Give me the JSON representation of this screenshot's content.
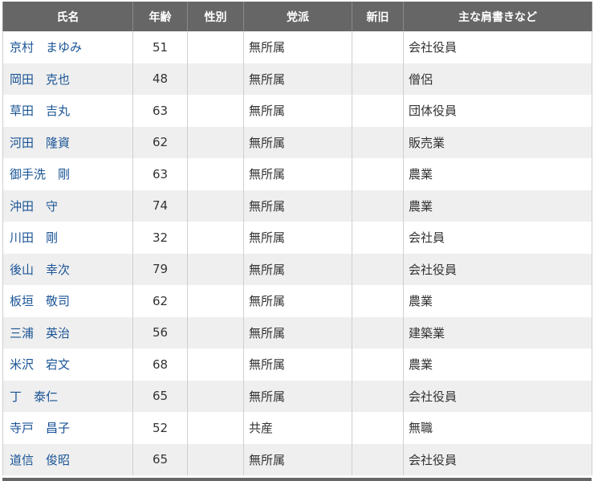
{
  "table": {
    "headers": [
      "氏名",
      "年齢",
      "性別",
      "党派",
      "新旧",
      "主な肩書きなど"
    ],
    "rows": [
      {
        "name": "京村　まゆみ",
        "age": "51",
        "gender": "",
        "party": "無所属",
        "status": "",
        "title": "会社役員"
      },
      {
        "name": "岡田　克也",
        "age": "48",
        "gender": "",
        "party": "無所属",
        "status": "",
        "title": "僧侶"
      },
      {
        "name": "草田　吉丸",
        "age": "63",
        "gender": "",
        "party": "無所属",
        "status": "",
        "title": "団体役員"
      },
      {
        "name": "河田　隆資",
        "age": "62",
        "gender": "",
        "party": "無所属",
        "status": "",
        "title": "販売業"
      },
      {
        "name": "御手洗　剛",
        "age": "63",
        "gender": "",
        "party": "無所属",
        "status": "",
        "title": "農業"
      },
      {
        "name": "沖田　守",
        "age": "74",
        "gender": "",
        "party": "無所属",
        "status": "",
        "title": "農業"
      },
      {
        "name": "川田　剛",
        "age": "32",
        "gender": "",
        "party": "無所属",
        "status": "",
        "title": "会社員"
      },
      {
        "name": "後山　幸次",
        "age": "79",
        "gender": "",
        "party": "無所属",
        "status": "",
        "title": "会社役員"
      },
      {
        "name": "板垣　敬司",
        "age": "62",
        "gender": "",
        "party": "無所属",
        "status": "",
        "title": "農業"
      },
      {
        "name": "三浦　英治",
        "age": "56",
        "gender": "",
        "party": "無所属",
        "status": "",
        "title": "建築業"
      },
      {
        "name": "米沢　宕文",
        "age": "68",
        "gender": "",
        "party": "無所属",
        "status": "",
        "title": "農業"
      },
      {
        "name": "丁　泰仁",
        "age": "65",
        "gender": "",
        "party": "無所属",
        "status": "",
        "title": "会社役員"
      },
      {
        "name": "寺戸　昌子",
        "age": "52",
        "gender": "",
        "party": "共産",
        "status": "",
        "title": "無職"
      },
      {
        "name": "道信　俊昭",
        "age": "65",
        "gender": "",
        "party": "無所属",
        "status": "",
        "title": "会社役員"
      }
    ]
  }
}
